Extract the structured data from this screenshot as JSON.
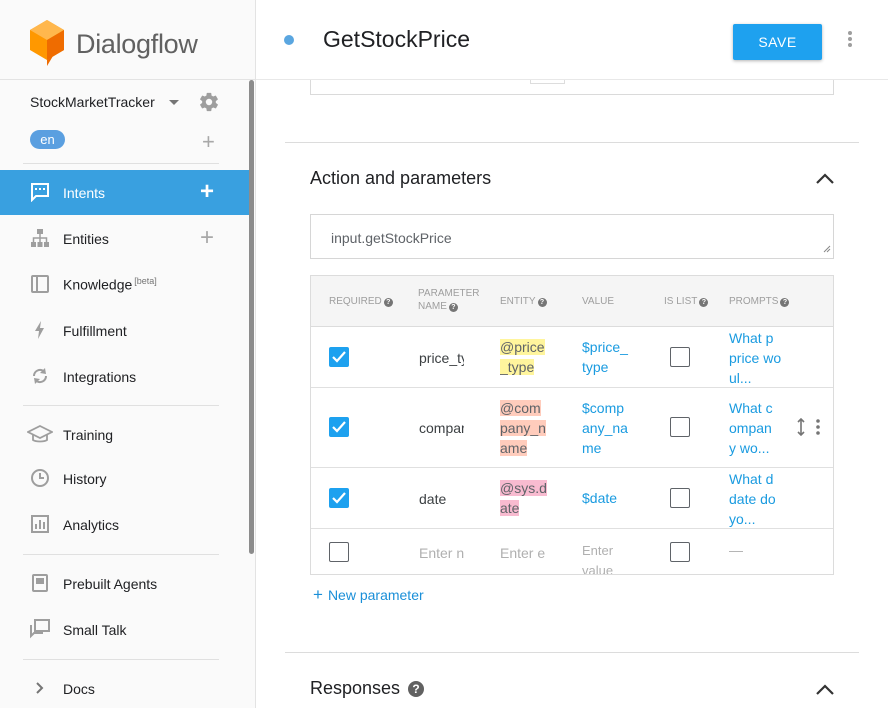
{
  "brand": {
    "name": "Dialogflow",
    "logo_color": "#f57c00"
  },
  "agent": {
    "name": "StockMarketTracker",
    "language": "en"
  },
  "nav": [
    {
      "label": "Intents",
      "icon": "chat-icon",
      "active": true,
      "has_add": true
    },
    {
      "label": "Entities",
      "icon": "hierarchy-icon",
      "has_add": true
    },
    {
      "label": "Knowledge",
      "badge": "[beta]",
      "icon": "book-icon"
    },
    {
      "label": "Fulfillment",
      "icon": "bolt-icon"
    },
    {
      "label": "Integrations",
      "icon": "sync-icon"
    },
    {
      "label": "Training",
      "icon": "graduation-cap-icon"
    },
    {
      "label": "History",
      "icon": "clock-icon"
    },
    {
      "label": "Analytics",
      "icon": "bar-chart-icon"
    },
    {
      "label": "Prebuilt Agents",
      "icon": "agent-book-icon"
    },
    {
      "label": "Small Talk",
      "icon": "small-talk-icon"
    },
    {
      "label": "Docs",
      "icon": "chevron-right-icon"
    }
  ],
  "header": {
    "title": "GetStockPrice",
    "save_label": "SAVE"
  },
  "action_section": {
    "title": "Action and parameters",
    "action_value": "input.getStockPrice",
    "columns": {
      "required": "REQUIRED",
      "parameter_name_1": "PARAMETER",
      "parameter_name_2": "NAME",
      "entity": "ENTITY",
      "value": "VALUE",
      "is_list": "IS LIST",
      "prompts": "PROMPTS"
    },
    "rows": [
      {
        "required": true,
        "name": "price_ty",
        "entity_l1": "@price",
        "entity_l2": "_type",
        "entity_l3": "",
        "value_l1": "$price_",
        "value_l2": "type",
        "value_l3": "",
        "is_list": false,
        "prompt_l1": "What p",
        "prompt_l2": "price wo",
        "prompt_l3": "ul..."
      },
      {
        "required": true,
        "name": "compar",
        "entity_l1": "@com",
        "entity_l2": "pany_n",
        "entity_l3": "ame",
        "value_l1": "$comp",
        "value_l2": "any_na",
        "value_l3": "me",
        "is_list": false,
        "prompt_l1": "What c",
        "prompt_l2": "ompan",
        "prompt_l3": "y wo..."
      },
      {
        "required": true,
        "name": "date",
        "entity_l1": "@sys.d",
        "entity_l2": "ate",
        "entity_l3": "",
        "value_l1": "$date",
        "value_l2": "",
        "value_l3": "",
        "is_list": false,
        "prompt_l1": "What d",
        "prompt_l2": "date do",
        "prompt_l3": "yo..."
      }
    ],
    "empty_row": {
      "name_placeholder": "Enter n",
      "entity_placeholder": "Enter e",
      "value_placeholder_l1": "Enter",
      "value_placeholder_l2": "value",
      "prompt_placeholder": "—"
    },
    "new_parameter_label": "New parameter"
  },
  "responses_section": {
    "title": "Responses",
    "help": "?"
  },
  "colors": {
    "accent": "#1ea1ef",
    "active_nav": "#39a0e0",
    "link": "#1a9be0"
  }
}
